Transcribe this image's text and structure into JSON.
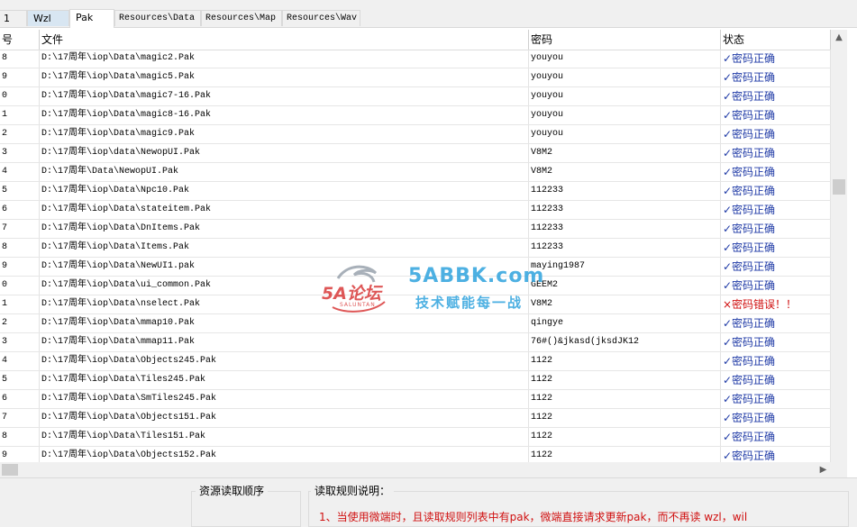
{
  "tabs": [
    "1",
    "Wzl",
    "Pak",
    "Resources\\Data",
    "Resources\\Map",
    "Resources\\Wav"
  ],
  "active_tab": "Pak",
  "columns": [
    "号",
    "文件",
    "密码",
    "状态"
  ],
  "rows": [
    {
      "no": "8",
      "file": "D:\\17周年\\iop\\Data\\magic2.Pak",
      "password": "youyou",
      "status": "✓密码正确",
      "ok": true
    },
    {
      "no": "9",
      "file": "D:\\17周年\\iop\\Data\\magic5.Pak",
      "password": "youyou",
      "status": "✓密码正确",
      "ok": true
    },
    {
      "no": "0",
      "file": "D:\\17周年\\iop\\Data\\magic7-16.Pak",
      "password": "youyou",
      "status": "✓密码正确",
      "ok": true
    },
    {
      "no": "1",
      "file": "D:\\17周年\\iop\\Data\\magic8-16.Pak",
      "password": "youyou",
      "status": "✓密码正确",
      "ok": true
    },
    {
      "no": "2",
      "file": "D:\\17周年\\iop\\Data\\magic9.Pak",
      "password": "youyou",
      "status": "✓密码正确",
      "ok": true
    },
    {
      "no": "3",
      "file": "D:\\17周年\\iop\\data\\NewopUI.Pak",
      "password": "V8M2",
      "status": "✓密码正确",
      "ok": true
    },
    {
      "no": "4",
      "file": "D:\\17周年\\Data\\NewopUI.Pak",
      "password": "V8M2",
      "status": "✓密码正确",
      "ok": true
    },
    {
      "no": "5",
      "file": "D:\\17周年\\iop\\Data\\Npc10.Pak",
      "password": "112233",
      "status": "✓密码正确",
      "ok": true
    },
    {
      "no": "6",
      "file": "D:\\17周年\\iop\\Data\\stateitem.Pak",
      "password": "112233",
      "status": "✓密码正确",
      "ok": true
    },
    {
      "no": "7",
      "file": "D:\\17周年\\iop\\Data\\DnItems.Pak",
      "password": "112233",
      "status": "✓密码正确",
      "ok": true
    },
    {
      "no": "8",
      "file": "D:\\17周年\\iop\\Data\\Items.Pak",
      "password": "112233",
      "status": "✓密码正确",
      "ok": true
    },
    {
      "no": "9",
      "file": "D:\\17周年\\iop\\Data\\NewUI1.pak",
      "password": "maying1987",
      "status": "✓密码正确",
      "ok": true
    },
    {
      "no": "0",
      "file": "D:\\17周年\\iop\\Data\\ui_common.Pak",
      "password": "GEEM2",
      "status": "✓密码正确",
      "ok": true
    },
    {
      "no": "1",
      "file": "D:\\17周年\\iop\\Data\\nselect.Pak",
      "password": "V8M2",
      "status": "×密码错误！！",
      "ok": false
    },
    {
      "no": "2",
      "file": "D:\\17周年\\iop\\Data\\mmap10.Pak",
      "password": "qingye",
      "status": "✓密码正确",
      "ok": true
    },
    {
      "no": "3",
      "file": "D:\\17周年\\iop\\Data\\mmap11.Pak",
      "password": "76#()&jkasd(jksdJK12",
      "status": "✓密码正确",
      "ok": true
    },
    {
      "no": "4",
      "file": "D:\\17周年\\iop\\Data\\Objects245.Pak",
      "password": "1122",
      "status": "✓密码正确",
      "ok": true
    },
    {
      "no": "5",
      "file": "D:\\17周年\\iop\\Data\\Tiles245.Pak",
      "password": "1122",
      "status": "✓密码正确",
      "ok": true
    },
    {
      "no": "6",
      "file": "D:\\17周年\\iop\\Data\\SmTiles245.Pak",
      "password": "1122",
      "status": "✓密码正确",
      "ok": true
    },
    {
      "no": "7",
      "file": "D:\\17周年\\iop\\Data\\Objects151.Pak",
      "password": "1122",
      "status": "✓密码正确",
      "ok": true
    },
    {
      "no": "8",
      "file": "D:\\17周年\\iop\\Data\\Tiles151.Pak",
      "password": "1122",
      "status": "✓密码正确",
      "ok": true
    },
    {
      "no": "9",
      "file": "D:\\17周年\\iop\\Data\\Objects152.Pak",
      "password": "1122",
      "status": "✓密码正确",
      "ok": true
    }
  ],
  "panels": {
    "resource_order_title": "资源读取顺序",
    "rules_title": "读取规则说明：",
    "rule_1": "1、当使用微端时，且读取规则列表中有pak，微端直接请求更新pak，而不再读 wzl，wil"
  },
  "watermark": {
    "logo_text": "5A论坛",
    "logo_sub": "SALUNTAN",
    "site": "5ABBK.com",
    "slogan": "技术赋能每一战"
  },
  "colors": {
    "status_ok": "#1f3aa6",
    "status_err": "#d01010",
    "watermark_blue": "#2ea3dd",
    "watermark_red": "#d93a3a"
  }
}
